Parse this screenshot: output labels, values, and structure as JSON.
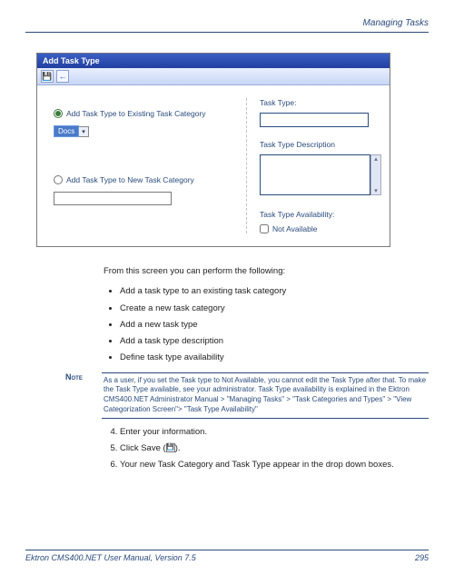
{
  "header": {
    "section_title": "Managing Tasks"
  },
  "window": {
    "title": "Add Task Type",
    "toolbar": {
      "save": "💾",
      "back": "←"
    }
  },
  "form": {
    "radio_existing": "Add Task Type to Existing Task Category",
    "dropdown_selected": "Docs",
    "radio_new": "Add Task Type to New Task Category",
    "new_cat_value": "",
    "task_type_label": "Task Type:",
    "task_type_value": "",
    "task_type_desc_label": "Task Type Description",
    "task_type_desc_value": "",
    "availability_label": "Task Type Availability:",
    "not_available_label": "Not Available"
  },
  "prose": {
    "intro": "From this screen you can perform the following:",
    "bullets": [
      "Add a task type to an existing task category",
      "Create a new task category",
      "Add a new task type",
      "Add a task type description",
      "Define task type availability"
    ],
    "note_label": "Note",
    "note_body": "As a user, if you set the Task type to Not Available, you cannot edit the Task Type after that. To make the Task Type available, see your administrator. Task Type availability is explained in the Ektron CMS400.NET Administrator Manual > \"Managing Tasks\" > \"Task Categories and Types\" > \"View Categorization Screen\"> \"Task Type Availability\"",
    "step4": "Enter your information.",
    "step5_a": "Click Save (",
    "step5_b": ").",
    "step6": "Your new Task Category and Task Type appear in the drop down boxes."
  },
  "footer": {
    "left": "Ektron CMS400.NET User Manual, Version 7.5",
    "right": "295"
  }
}
